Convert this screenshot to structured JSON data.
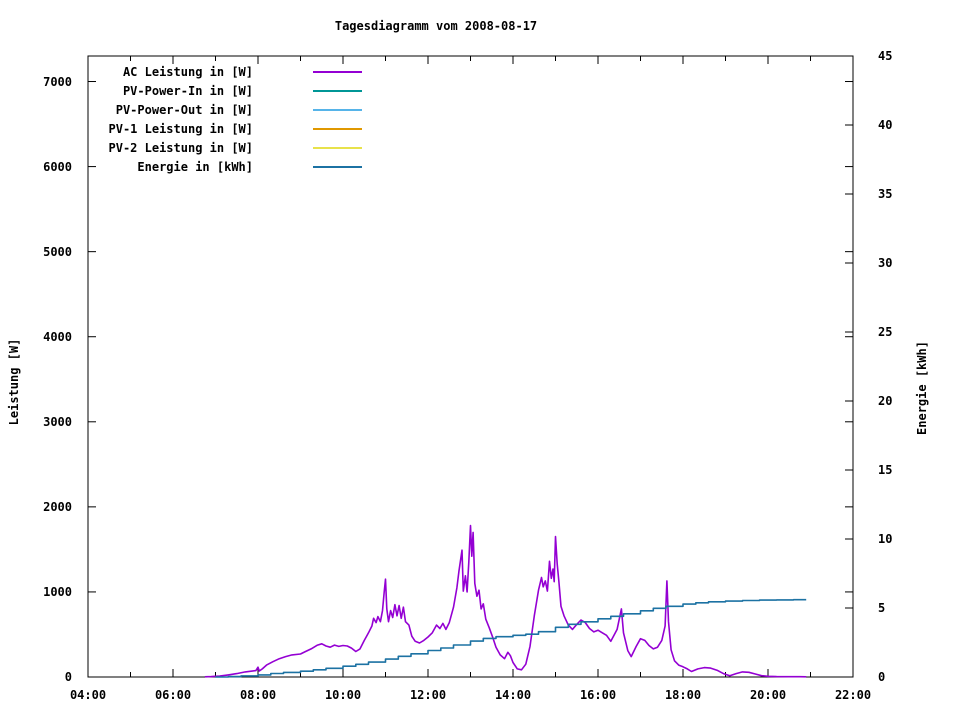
{
  "window": {
    "background": "#ffffff",
    "text_color": "#000000"
  },
  "chart_data": {
    "type": "line",
    "title": "Tagesdiagramm vom 2008-08-17",
    "xlabel": "",
    "ylabel_left": "Leistung [W]",
    "ylabel_right": "Energie [kWh]",
    "grid": false,
    "legend_position": "top-left-inside",
    "border_color": "#000000",
    "x_range_hours": [
      4,
      22
    ],
    "x_major_ticks": [
      {
        "hour": 4,
        "label": "04:00"
      },
      {
        "hour": 6,
        "label": "06:00"
      },
      {
        "hour": 8,
        "label": "08:00"
      },
      {
        "hour": 10,
        "label": "10:00"
      },
      {
        "hour": 12,
        "label": "12:00"
      },
      {
        "hour": 14,
        "label": "14:00"
      },
      {
        "hour": 16,
        "label": "16:00"
      },
      {
        "hour": 18,
        "label": "18:00"
      },
      {
        "hour": 20,
        "label": "20:00"
      },
      {
        "hour": 22,
        "label": "22:00"
      }
    ],
    "x_minor_step_hours": 1,
    "ylim_left": [
      0,
      7300
    ],
    "yticks_left": [
      0,
      1000,
      2000,
      3000,
      4000,
      5000,
      6000,
      7000
    ],
    "ylim_right": [
      0,
      45
    ],
    "yticks_right": [
      0,
      5,
      10,
      15,
      20,
      25,
      30,
      35,
      40,
      45
    ],
    "series": [
      {
        "name": "AC Leistung in [W]",
        "color": "#9400d3",
        "axis": "left",
        "style": "line",
        "points": [
          [
            6.75,
            2
          ],
          [
            6.9,
            5
          ],
          [
            7.1,
            10
          ],
          [
            7.3,
            25
          ],
          [
            7.5,
            40
          ],
          [
            7.7,
            60
          ],
          [
            7.95,
            75
          ],
          [
            8.0,
            115
          ],
          [
            8.03,
            70
          ],
          [
            8.1,
            95
          ],
          [
            8.2,
            140
          ],
          [
            8.35,
            180
          ],
          [
            8.5,
            215
          ],
          [
            8.65,
            240
          ],
          [
            8.8,
            260
          ],
          [
            9.0,
            270
          ],
          [
            9.1,
            295
          ],
          [
            9.25,
            330
          ],
          [
            9.4,
            375
          ],
          [
            9.5,
            390
          ],
          [
            9.6,
            365
          ],
          [
            9.7,
            350
          ],
          [
            9.8,
            375
          ],
          [
            9.9,
            360
          ],
          [
            10.0,
            370
          ],
          [
            10.1,
            365
          ],
          [
            10.2,
            340
          ],
          [
            10.3,
            300
          ],
          [
            10.4,
            330
          ],
          [
            10.5,
            430
          ],
          [
            10.6,
            520
          ],
          [
            10.68,
            600
          ],
          [
            10.72,
            690
          ],
          [
            10.78,
            640
          ],
          [
            10.82,
            710
          ],
          [
            10.88,
            650
          ],
          [
            10.93,
            780
          ],
          [
            10.97,
            1000
          ],
          [
            11.0,
            1150
          ],
          [
            11.03,
            800
          ],
          [
            11.07,
            650
          ],
          [
            11.12,
            780
          ],
          [
            11.17,
            700
          ],
          [
            11.22,
            850
          ],
          [
            11.27,
            720
          ],
          [
            11.32,
            840
          ],
          [
            11.37,
            690
          ],
          [
            11.42,
            820
          ],
          [
            11.47,
            650
          ],
          [
            11.55,
            610
          ],
          [
            11.62,
            480
          ],
          [
            11.7,
            420
          ],
          [
            11.8,
            400
          ],
          [
            11.9,
            430
          ],
          [
            12.0,
            470
          ],
          [
            12.1,
            520
          ],
          [
            12.2,
            610
          ],
          [
            12.28,
            570
          ],
          [
            12.35,
            630
          ],
          [
            12.42,
            560
          ],
          [
            12.5,
            640
          ],
          [
            12.6,
            820
          ],
          [
            12.68,
            1050
          ],
          [
            12.73,
            1250
          ],
          [
            12.8,
            1490
          ],
          [
            12.83,
            1010
          ],
          [
            12.88,
            1190
          ],
          [
            12.92,
            1000
          ],
          [
            12.96,
            1350
          ],
          [
            13.0,
            1780
          ],
          [
            13.03,
            1420
          ],
          [
            13.06,
            1700
          ],
          [
            13.1,
            1100
          ],
          [
            13.15,
            950
          ],
          [
            13.2,
            1020
          ],
          [
            13.25,
            800
          ],
          [
            13.3,
            860
          ],
          [
            13.36,
            680
          ],
          [
            13.44,
            580
          ],
          [
            13.52,
            470
          ],
          [
            13.6,
            350
          ],
          [
            13.7,
            260
          ],
          [
            13.8,
            215
          ],
          [
            13.88,
            290
          ],
          [
            13.94,
            250
          ],
          [
            14.0,
            170
          ],
          [
            14.1,
            95
          ],
          [
            14.2,
            85
          ],
          [
            14.3,
            150
          ],
          [
            14.4,
            360
          ],
          [
            14.5,
            720
          ],
          [
            14.6,
            1020
          ],
          [
            14.67,
            1170
          ],
          [
            14.71,
            1060
          ],
          [
            14.76,
            1130
          ],
          [
            14.81,
            1010
          ],
          [
            14.86,
            1360
          ],
          [
            14.9,
            1160
          ],
          [
            14.94,
            1270
          ],
          [
            14.97,
            1120
          ],
          [
            15.0,
            1650
          ],
          [
            15.04,
            1330
          ],
          [
            15.08,
            1120
          ],
          [
            15.13,
            830
          ],
          [
            15.2,
            720
          ],
          [
            15.3,
            610
          ],
          [
            15.4,
            560
          ],
          [
            15.5,
            620
          ],
          [
            15.6,
            670
          ],
          [
            15.7,
            640
          ],
          [
            15.8,
            570
          ],
          [
            15.9,
            530
          ],
          [
            16.0,
            550
          ],
          [
            16.1,
            520
          ],
          [
            16.2,
            490
          ],
          [
            16.3,
            420
          ],
          [
            16.45,
            560
          ],
          [
            16.55,
            800
          ],
          [
            16.6,
            520
          ],
          [
            16.7,
            310
          ],
          [
            16.78,
            240
          ],
          [
            16.9,
            360
          ],
          [
            17.0,
            450
          ],
          [
            17.1,
            430
          ],
          [
            17.2,
            370
          ],
          [
            17.3,
            330
          ],
          [
            17.4,
            350
          ],
          [
            17.5,
            430
          ],
          [
            17.58,
            600
          ],
          [
            17.62,
            1130
          ],
          [
            17.66,
            650
          ],
          [
            17.72,
            320
          ],
          [
            17.8,
            190
          ],
          [
            17.9,
            140
          ],
          [
            18.0,
            120
          ],
          [
            18.1,
            95
          ],
          [
            18.2,
            65
          ],
          [
            18.35,
            95
          ],
          [
            18.5,
            110
          ],
          [
            18.65,
            105
          ],
          [
            18.8,
            80
          ],
          [
            18.95,
            40
          ],
          [
            19.1,
            15
          ],
          [
            19.25,
            40
          ],
          [
            19.4,
            60
          ],
          [
            19.55,
            55
          ],
          [
            19.7,
            35
          ],
          [
            19.85,
            15
          ],
          [
            20.0,
            8
          ],
          [
            20.2,
            5
          ],
          [
            20.5,
            4
          ],
          [
            20.75,
            4
          ],
          [
            20.9,
            2
          ]
        ]
      },
      {
        "name": "PV-Power-In in [W]",
        "color": "#009696",
        "axis": "left",
        "style": "line",
        "points": []
      },
      {
        "name": "PV-Power-Out in [W]",
        "color": "#56b4e9",
        "axis": "left",
        "style": "line",
        "points": []
      },
      {
        "name": "PV-1 Leistung in [W]",
        "color": "#e09800",
        "axis": "left",
        "style": "line",
        "points": []
      },
      {
        "name": "PV-2 Leistung in [W]",
        "color": "#e8e24b",
        "axis": "left",
        "style": "line",
        "points": []
      },
      {
        "name": "Energie in [kWh]",
        "color": "#1c72a3",
        "axis": "right",
        "style": "steps",
        "points": [
          [
            7.0,
            0
          ],
          [
            7.3,
            0.03
          ],
          [
            7.6,
            0.08
          ],
          [
            8.0,
            0.15
          ],
          [
            8.3,
            0.25
          ],
          [
            8.6,
            0.33
          ],
          [
            9.0,
            0.42
          ],
          [
            9.3,
            0.52
          ],
          [
            9.6,
            0.63
          ],
          [
            10.0,
            0.78
          ],
          [
            10.3,
            0.92
          ],
          [
            10.6,
            1.08
          ],
          [
            11.0,
            1.3
          ],
          [
            11.3,
            1.5
          ],
          [
            11.6,
            1.68
          ],
          [
            12.0,
            1.92
          ],
          [
            12.3,
            2.1
          ],
          [
            12.6,
            2.32
          ],
          [
            13.0,
            2.6
          ],
          [
            13.3,
            2.8
          ],
          [
            13.6,
            2.92
          ],
          [
            14.0,
            3.02
          ],
          [
            14.3,
            3.1
          ],
          [
            14.6,
            3.28
          ],
          [
            15.0,
            3.6
          ],
          [
            15.3,
            3.82
          ],
          [
            15.6,
            4.0
          ],
          [
            16.0,
            4.22
          ],
          [
            16.3,
            4.4
          ],
          [
            16.6,
            4.58
          ],
          [
            17.0,
            4.8
          ],
          [
            17.3,
            4.98
          ],
          [
            17.6,
            5.12
          ],
          [
            18.0,
            5.28
          ],
          [
            18.3,
            5.38
          ],
          [
            18.6,
            5.45
          ],
          [
            19.0,
            5.5
          ],
          [
            19.4,
            5.54
          ],
          [
            19.8,
            5.57
          ],
          [
            20.2,
            5.59
          ],
          [
            20.6,
            5.6
          ],
          [
            20.9,
            5.6
          ]
        ]
      }
    ]
  }
}
